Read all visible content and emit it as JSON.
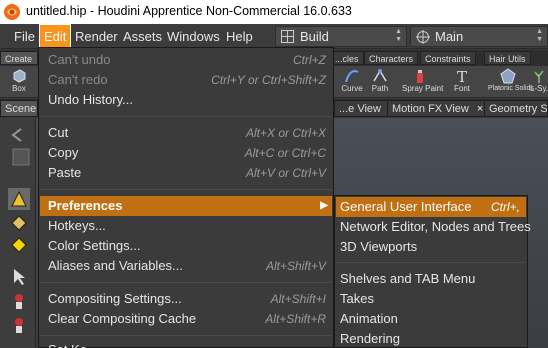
{
  "window": {
    "title": "untitled.hip - Houdini Apprentice Non-Commercial 16.0.633"
  },
  "menubar": {
    "items": [
      "File",
      "Edit",
      "Render",
      "Assets",
      "Windows",
      "Help"
    ],
    "desktop_label": "Build",
    "viewport_label": "Main"
  },
  "shelf": {
    "tabs": [
      "Create",
      "...cles",
      "Characters",
      "Constraints",
      "Hair Utils"
    ],
    "tools": [
      "Box",
      "Curve",
      "Path",
      "Spray Paint",
      "Font",
      "Platonic Solids",
      "L-Sy..."
    ]
  },
  "panes": {
    "tabs": [
      "Scene",
      "...e View",
      "Motion FX View",
      "Geometry Spr..."
    ]
  },
  "edit_menu": {
    "items": [
      {
        "label": "Can't undo",
        "shortcut": "Ctrl+Z"
      },
      {
        "label": "Can't redo",
        "shortcut": "Ctrl+Y or Ctrl+Shift+Z"
      },
      {
        "label": "Undo History...",
        "shortcut": ""
      },
      {
        "label": "Cut",
        "shortcut": "Alt+X or Ctrl+X"
      },
      {
        "label": "Copy",
        "shortcut": "Alt+C or Ctrl+C"
      },
      {
        "label": "Paste",
        "shortcut": "Alt+V or Ctrl+V"
      },
      {
        "label": "Preferences",
        "shortcut": ""
      },
      {
        "label": "Hotkeys...",
        "shortcut": ""
      },
      {
        "label": "Color Settings...",
        "shortcut": ""
      },
      {
        "label": "Aliases and Variables...",
        "shortcut": "Alt+Shift+V"
      },
      {
        "label": "Compositing Settings...",
        "shortcut": "Alt+Shift+I"
      },
      {
        "label": "Clear Compositing Cache",
        "shortcut": "Alt+Shift+R"
      },
      {
        "label": "Set Ke...",
        "shortcut": ""
      }
    ]
  },
  "preferences_submenu": {
    "items": [
      {
        "label": "General User Interface",
        "shortcut": "Ctrl+,"
      },
      {
        "label": "Network Editor, Nodes and Trees",
        "shortcut": ""
      },
      {
        "label": "3D Viewports",
        "shortcut": ""
      },
      {
        "label": "Shelves and TAB Menu",
        "shortcut": ""
      },
      {
        "label": "Takes",
        "shortcut": ""
      },
      {
        "label": "Animation",
        "shortcut": ""
      },
      {
        "label": "Rendering",
        "shortcut": ""
      }
    ]
  },
  "colors": {
    "accent": "#f7941d",
    "highlight": "#c06f12",
    "menu_bg": "#3b3b3b"
  }
}
